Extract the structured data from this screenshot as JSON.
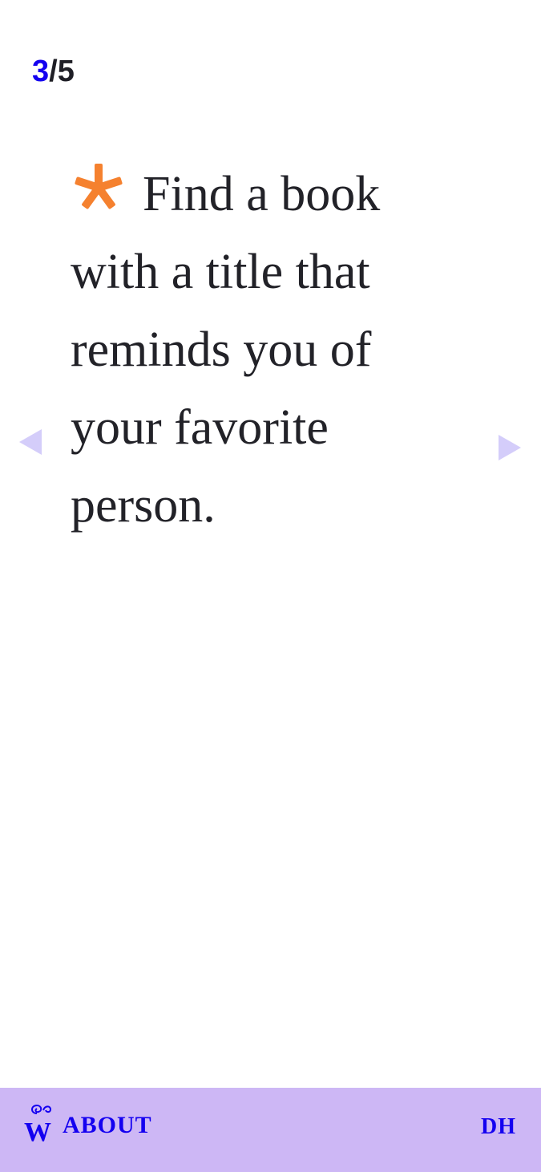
{
  "counter": {
    "current": "3",
    "total": "/5"
  },
  "prompt": {
    "text": "Find a book with a title that reminds you of your favorite person."
  },
  "icons": {
    "bullet": "asterisk-icon",
    "previous": "triangle-left-icon",
    "next": "triangle-right-icon",
    "logo": "w-monogram-logo"
  },
  "footer": {
    "about_label": "ABOUT",
    "dh_label": "DH"
  },
  "colors": {
    "accent_blue": "#1400f0",
    "asterisk_orange": "#f5812f",
    "arrow_lavender": "#d4cdfa",
    "footer_bg": "#cdb7f5",
    "text": "#222228"
  }
}
